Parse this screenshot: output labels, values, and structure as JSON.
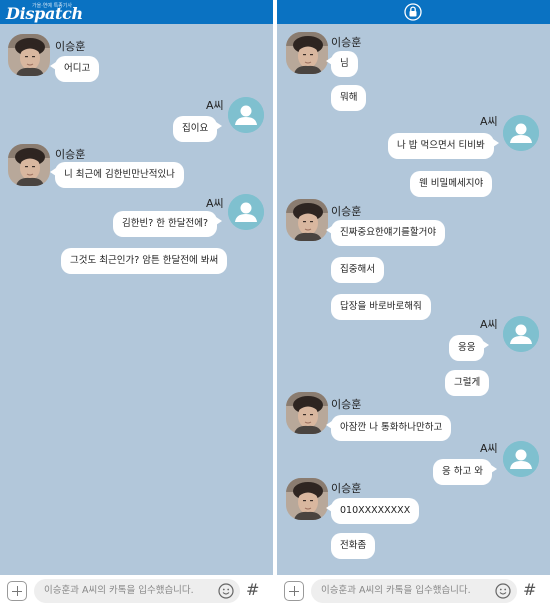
{
  "header": {
    "logo_text": "Dispatch",
    "logo_subtext": "가을·연예 특종기사"
  },
  "composer": {
    "placeholder": "이승훈과 A씨의 카톡을 입수했습니다."
  },
  "left_chat": {
    "messages": [
      {
        "sender": "이승훈",
        "side": "left",
        "texts": [
          "어디고"
        ]
      },
      {
        "sender": "A씨",
        "side": "right",
        "texts": [
          "집이요"
        ]
      },
      {
        "sender": "이승훈",
        "side": "left",
        "texts": [
          "니 최근에 김한빈만난적있나"
        ]
      },
      {
        "sender": "A씨",
        "side": "right",
        "texts": [
          "김한빈? 한 한달전에?",
          "그것도 최근인가? 암튼 한달전에 봐써"
        ]
      }
    ]
  },
  "right_chat": {
    "messages": [
      {
        "sender": "이승훈",
        "side": "left",
        "texts": [
          "님",
          "뭐해"
        ]
      },
      {
        "sender": "A씨",
        "side": "right",
        "texts": [
          "나 밥 먹으면서 티비봐",
          "웬 비밀메세지야"
        ]
      },
      {
        "sender": "이승훈",
        "side": "left",
        "texts": [
          "진짜중요한얘기를할거야",
          "집중해서",
          "답장을 바로바로해줘"
        ]
      },
      {
        "sender": "A씨",
        "side": "right",
        "texts": [
          "응응",
          "그럴게"
        ]
      },
      {
        "sender": "이승훈",
        "side": "left",
        "texts": [
          "아잠깐 나 통화하나만하고"
        ]
      },
      {
        "sender": "A씨",
        "side": "right",
        "texts": [
          "응 하고 와"
        ]
      },
      {
        "sender": "이승훈",
        "side": "left",
        "texts": [
          "010XXXXXXXX",
          "전화좀"
        ]
      }
    ]
  },
  "colors": {
    "chat_background": "#b2c7da",
    "header_blue": "#0a72c2",
    "bubble": "#ffffff",
    "my_avatar": "#7fc0cf"
  }
}
